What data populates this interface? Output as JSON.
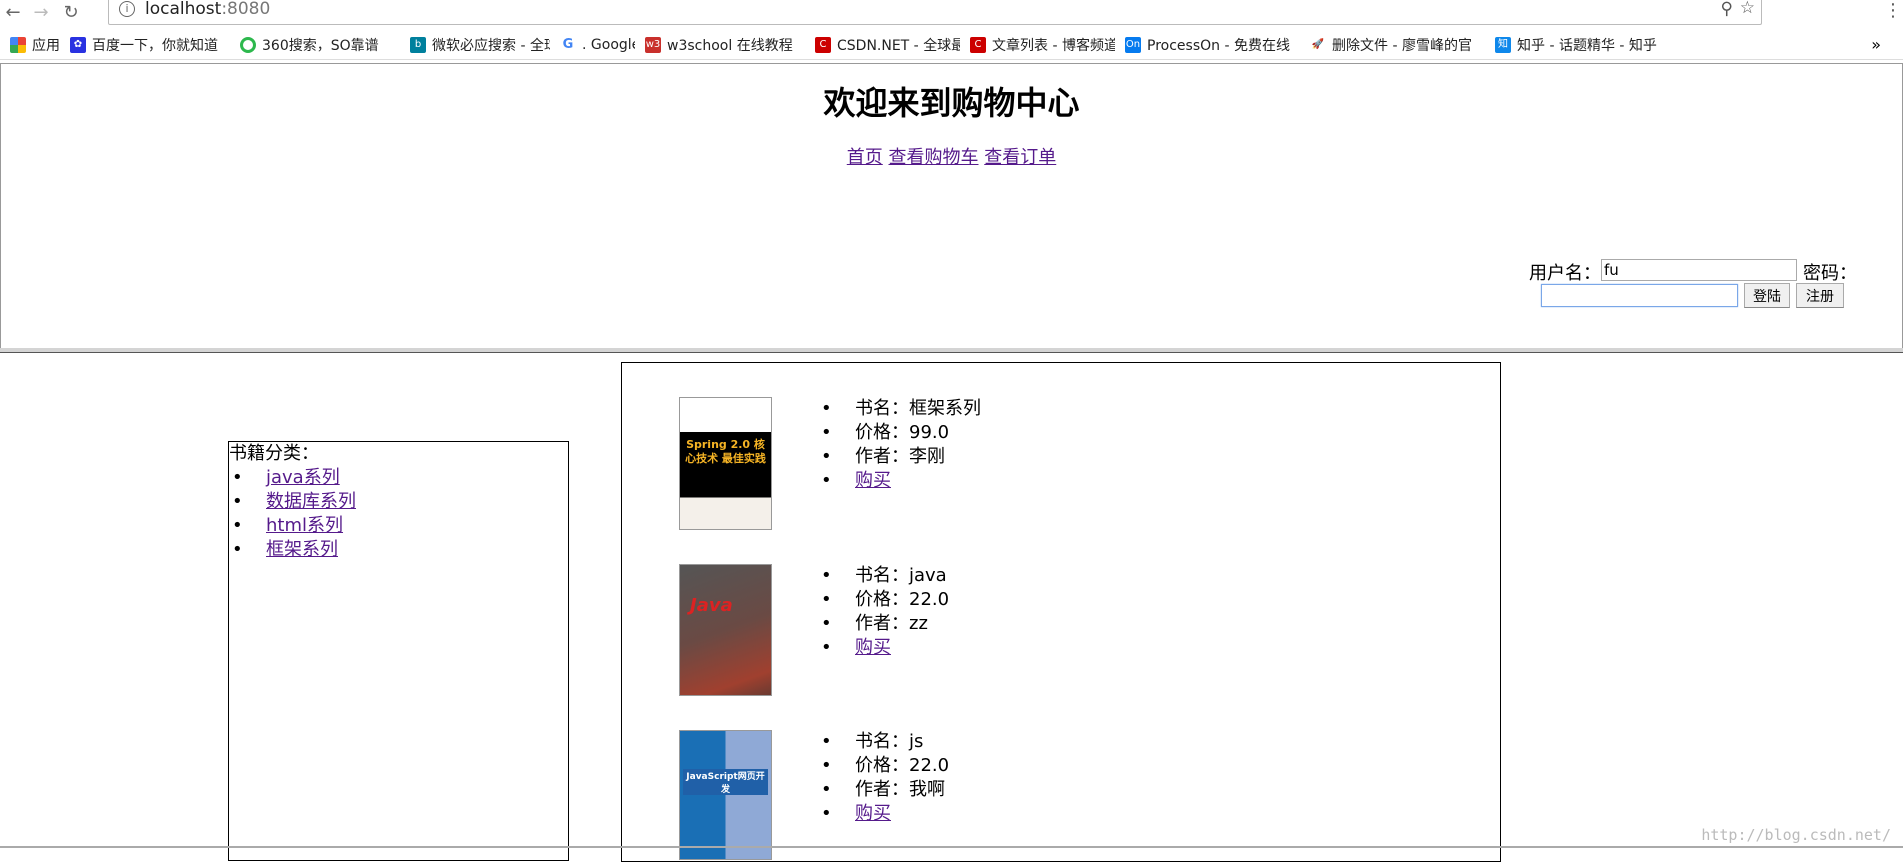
{
  "browser": {
    "url_host": "localhost",
    "url_port": ":8080",
    "bookmarks": [
      "应用",
      "百度一下，你就知道",
      "360搜索，SO靠谱",
      "微软必应搜索 - 全球",
      ". Google",
      "w3school 在线教程",
      "CSDN.NET - 全球最大",
      "文章列表 - 博客频道 -",
      "ProcessOn - 免费在线",
      "删除文件 - 廖雪峰的官",
      "知乎 - 话题精华 - 知乎"
    ],
    "overflow": "»"
  },
  "header": {
    "title": "欢迎来到购物中心",
    "nav": [
      "首页",
      "查看购物车",
      "查看订单"
    ]
  },
  "login": {
    "username_label": "用户名：",
    "username_value": "fu",
    "password_label": "密码：",
    "password_value": "",
    "login_button": "登陆",
    "register_button": "注册"
  },
  "categories": {
    "heading": "书籍分类：",
    "items": [
      "java系列",
      "数据库系列",
      "html系列",
      "框架系列"
    ]
  },
  "books": [
    {
      "name": "书名：框架系列",
      "price": "价格：99.0",
      "author": "作者：李刚",
      "buy": "购买",
      "cover_text": "Spring 2.0 核心技术 最佳实践"
    },
    {
      "name": "书名：java",
      "price": "价格：22.0",
      "author": "作者：zz",
      "buy": "购买",
      "cover_text": "Java"
    },
    {
      "name": "书名：js",
      "price": "价格：22.0",
      "author": "作者：我啊",
      "buy": "购买",
      "cover_text": "JavaScript网页开发"
    }
  ],
  "watermark": "http://blog.csdn.net/"
}
